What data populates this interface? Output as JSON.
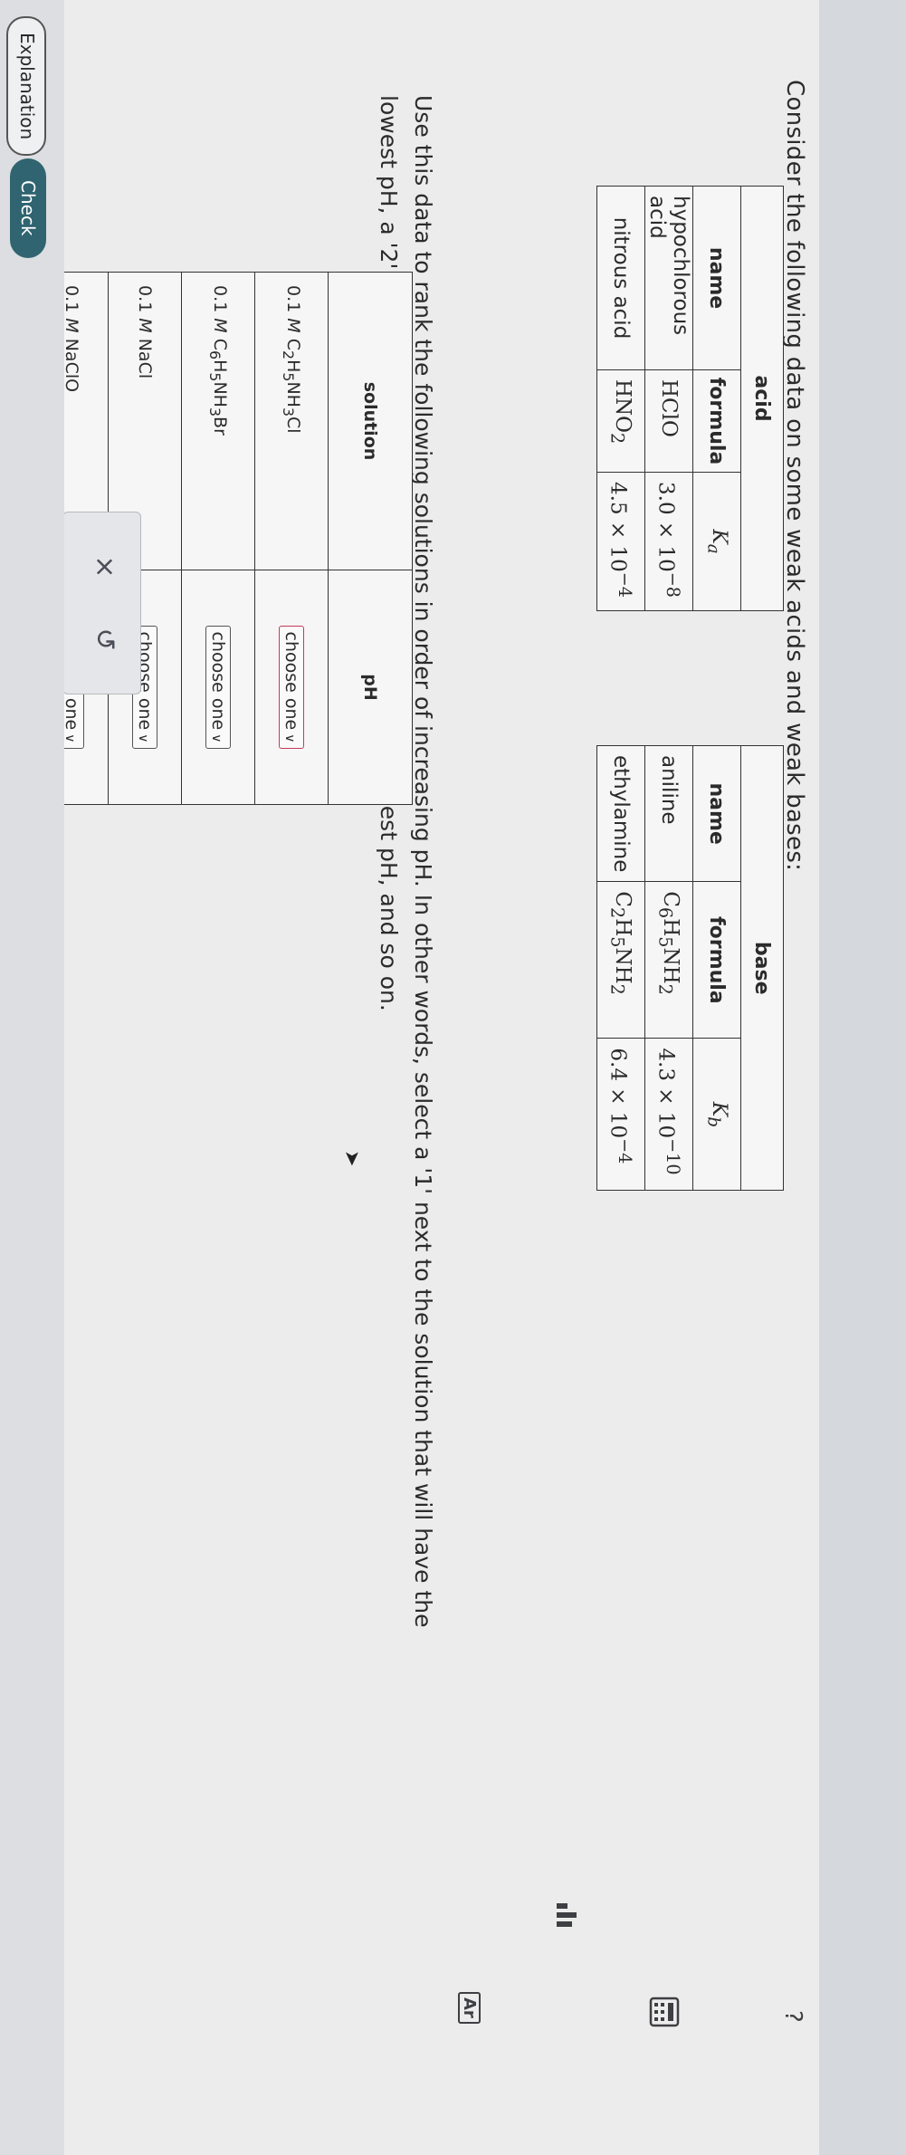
{
  "prompt": "Consider the following data on some weak acids and weak bases:",
  "acid_table": {
    "group_label": "acid",
    "headers": {
      "name": "name",
      "formula": "formula",
      "k": "K",
      "k_sub": "a"
    },
    "rows": [
      {
        "name": "hypochlorous acid",
        "formula": "HClO",
        "k_mant": "3.0 × 10",
        "k_exp": "−8"
      },
      {
        "name": "nitrous acid",
        "formula_main": "HNO",
        "formula_sub": "2",
        "k_mant": "4.5 × 10",
        "k_exp": "−4"
      }
    ]
  },
  "base_table": {
    "group_label": "base",
    "headers": {
      "name": "name",
      "formula": "formula",
      "k": "K",
      "k_sub": "b"
    },
    "rows": [
      {
        "name": "aniline",
        "formula": [
          "C",
          "6",
          "H",
          "5",
          "NH",
          "2"
        ],
        "k_mant": "4.3 × 10",
        "k_exp": "−10"
      },
      {
        "name": "ethylamine",
        "formula": [
          "C",
          "2",
          "H",
          "5",
          "NH",
          "2"
        ],
        "k_mant": "6.4 × 10",
        "k_exp": "−4"
      }
    ]
  },
  "instructions": "Use this data to rank the following solutions in order of increasing pH. In other words, select a '1' next to the solution that will have the lowest pH, a '2' next to the solution that will have the next lowest pH, and so on.",
  "rank_table": {
    "headers": {
      "solution": "solution",
      "ph": "pH"
    },
    "rows": [
      {
        "conc": "0.1",
        "unit": "M",
        "formula": [
          "C",
          "2",
          "H",
          "5",
          "NH",
          "3",
          "Cl",
          ""
        ],
        "select": "choose one"
      },
      {
        "conc": "0.1",
        "unit": "M",
        "formula": [
          "C",
          "6",
          "H",
          "5",
          "NH",
          "3",
          "Br",
          ""
        ],
        "select": "choose one"
      },
      {
        "conc": "0.1",
        "unit": "M",
        "formula": [
          "NaCl",
          "",
          "",
          "",
          "",
          "",
          "",
          ""
        ],
        "select": "choose one"
      },
      {
        "conc": "0.1",
        "unit": "M",
        "formula": [
          "NaClO",
          "",
          "",
          "",
          "",
          "",
          "",
          ""
        ],
        "select": "choose one"
      }
    ]
  },
  "actions": {
    "clear": "×",
    "undo": "↺"
  },
  "bottom": {
    "explanation": "Explanation",
    "check": "Check"
  },
  "side_icons": {
    "data": "data-icon",
    "help": "?",
    "periodic": "Ar"
  },
  "colors": {
    "check_bg": "#2f6470",
    "active_select": "#c63a5a"
  }
}
